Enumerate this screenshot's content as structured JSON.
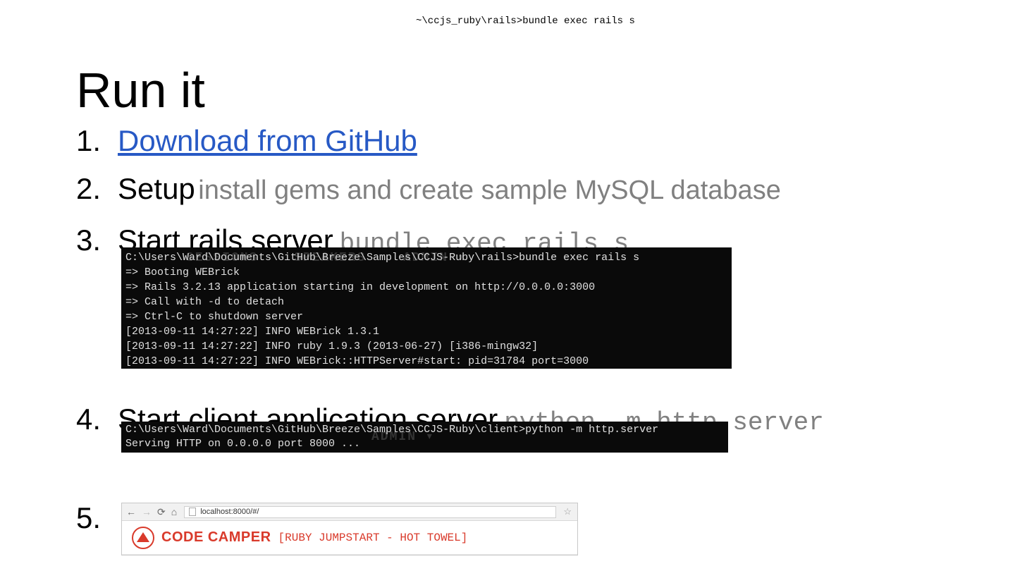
{
  "top_path": "~\\ccjs_ruby\\rails>bundle exec rails s",
  "title": "Run it",
  "steps": {
    "s1": {
      "num": "1.",
      "link": "Download from GitHub"
    },
    "s2": {
      "num": "2.",
      "label": "Setup",
      "sub": "install gems and create sample MySQL database"
    },
    "s3": {
      "num": "3.",
      "label": "Start rails server",
      "cmd": "bundle exec rails s"
    },
    "s4": {
      "num": "4.",
      "label": "Start client application server",
      "cmd": "python -m http.server"
    },
    "s5": {
      "num": "5."
    }
  },
  "terminal1": {
    "lines": [
      "C:\\Users\\Ward\\Documents\\GitHub\\Breeze\\Samples\\CCJS-Ruby\\rails>bundle exec rails s",
      "=> Booting WEBrick",
      "=> Rails 3.2.13 application starting in development on http://0.0.0.0:3000",
      "=> Call with -d to detach",
      "=> Ctrl-C to shutdown server",
      "[2013-09-11 14:27:22] INFO  WEBrick 1.3.1",
      "[2013-09-11 14:27:22] INFO  ruby 1.9.3 (2013-06-27) [i386-mingw32]",
      "[2013-09-11 14:27:22] INFO  WEBrick::HTTPServer#start: pid=31784 port=3000"
    ]
  },
  "terminal2": {
    "lines": [
      "C:\\Users\\Ward\\Documents\\GitHub\\Breeze\\Samples\\CCJS-Ruby\\client>python -m http.server",
      "Serving HTTP on 0.0.0.0 port 8000 ..."
    ]
  },
  "ghost": {
    "sessions": "SESSIONS",
    "speakers": "SPEAKERS",
    "admin": "ADMIN",
    "caret": "▾"
  },
  "browser": {
    "url": "localhost:8000/#/",
    "brand": "CODE CAMPER",
    "tagline": "[RUBY JUMPSTART - HOT TOWEL]"
  }
}
